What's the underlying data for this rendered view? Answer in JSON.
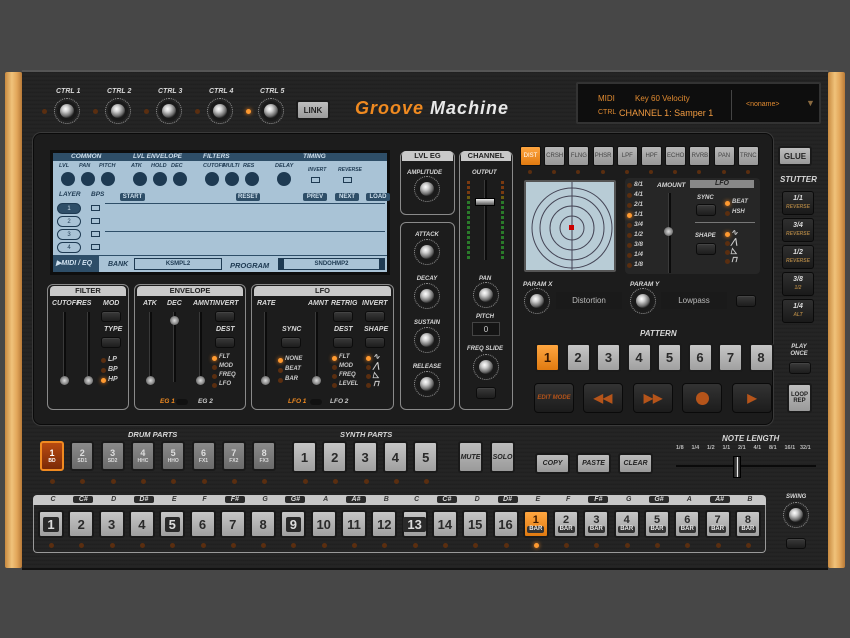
{
  "app": {
    "title_part1": "Groove",
    "title_part2": "Machine"
  },
  "top_controls": {
    "knobs": [
      {
        "label": "CTRL 1"
      },
      {
        "label": "CTRL 2"
      },
      {
        "label": "CTRL 3"
      },
      {
        "label": "CTRL 4"
      },
      {
        "label": "CTRL 5"
      }
    ],
    "active_led_index": 4,
    "link_label": "LINK"
  },
  "midi_display": {
    "midi_label": "MIDI",
    "midi_value": "Key 60 Velocity",
    "ctrl_label": "CTRL",
    "ctrl_value": "CHANNEL 1: Samper 1",
    "preset": "<noname>"
  },
  "lcd": {
    "sections": [
      "COMMON",
      "LVL ENVELOPE",
      "FILTERS",
      "TIMING"
    ],
    "knob_labels": [
      "LVL",
      "PAN",
      "PITCH",
      "ATK",
      "HOLD",
      "DEC",
      "CUTOFF",
      "MULTI",
      "RES",
      "DELAY"
    ],
    "toggle_labels": [
      "INVERT",
      "REVERSE"
    ],
    "layer_header": "LAYER",
    "bps_header": "BPS",
    "layers": [
      "1",
      "2",
      "3",
      "4"
    ],
    "selected_layer": 0,
    "buttons": [
      "START",
      "RESET",
      "PREV",
      "NEXT",
      "LOAD"
    ],
    "midi_eq": "MIDI / EQ",
    "bank_label": "BANK",
    "bank_value": "KSMPL2",
    "program_label": "PROGRAM",
    "program_value": "SNDOHMP2"
  },
  "filter": {
    "title": "FILTER",
    "sliders": [
      "CUTOFF",
      "RES"
    ],
    "mod_label": "MOD",
    "type_label": "TYPE",
    "types": [
      "LP",
      "BP",
      "HP"
    ],
    "active_type": 2
  },
  "envelope": {
    "title": "ENVELOPE",
    "sliders": [
      "ATK",
      "DEC",
      "AMNT"
    ],
    "invert_label": "INVERT",
    "dest_label": "DEST",
    "dests": [
      "FLT",
      "MOD",
      "FREQ",
      "LFO"
    ],
    "active_dest": 0,
    "switch_a": "EG 1",
    "switch_b": "EG 2"
  },
  "lfo": {
    "title": "LFO",
    "sliders": [
      "RATE",
      "AMNT"
    ],
    "sync_label": "SYNC",
    "sync_opts": [
      "NONE",
      "BEAT",
      "BAR"
    ],
    "active_sync": 0,
    "retrig_label": "RETRIG",
    "invert_label": "INVERT",
    "dest_label": "DEST",
    "shape_label": "SHAPE",
    "dests": [
      "FLT",
      "MOD",
      "FREQ",
      "LEVEL"
    ],
    "active_dest": 0,
    "shapes": [
      "sine",
      "triangle",
      "saw",
      "square"
    ],
    "active_shape": 0,
    "switch_a": "LFO 1",
    "switch_b": "LFO 2"
  },
  "lvl_eg": {
    "title": "LVL EG",
    "amplitude": "AMPLITUDE",
    "knobs": [
      "ATTACK",
      "DECAY",
      "SUSTAIN",
      "RELEASE"
    ]
  },
  "channel": {
    "title": "CHANNEL",
    "output": "OUTPUT",
    "pan": "PAN",
    "pitch_label": "PITCH",
    "pitch_value": "0",
    "freq_slide": "FREQ SLIDE"
  },
  "fx": {
    "tabs": [
      "DIST",
      "CRSH",
      "FLNG",
      "PHSR",
      "LPF",
      "HPF",
      "ECHO",
      "RVRB",
      "PAN",
      "TRNC"
    ],
    "active_tab": 0,
    "rates": [
      "8/1",
      "4/1",
      "2/1",
      "1/1",
      "3/4",
      "1/2",
      "3/8",
      "1/4",
      "1/8"
    ],
    "active_rate": 3,
    "amount_label": "AMOUNT",
    "lfo_label": "LFO",
    "sync_label": "SYNC",
    "sync_opts": [
      "BEAT",
      "HSH"
    ],
    "active_sync": 0,
    "shape_label": "SHAPE",
    "param_x_label": "PARAM X",
    "param_x_value": "Distortion",
    "param_y_label": "PARAM Y",
    "param_y_value": "Lowpass"
  },
  "right_side": {
    "glue": "GLUE",
    "stutter": "STUTTER",
    "stutter_buttons": [
      {
        "top": "1/1",
        "sub": "REVERSE"
      },
      {
        "top": "3/4",
        "sub": "REVERSE"
      },
      {
        "top": "1/2",
        "sub": "REVERSE"
      },
      {
        "top": "3/8",
        "sub": "1/2"
      },
      {
        "top": "1/4",
        "sub": "ALT"
      }
    ],
    "play_once": "PLAY ONCE",
    "loop_rep": "LOOP REP"
  },
  "pattern": {
    "title": "PATTERN",
    "items": [
      "1",
      "2",
      "3",
      "4",
      "5",
      "6",
      "7",
      "8"
    ],
    "active": 0,
    "edit_mode": "EDIT MODE"
  },
  "drum_parts": {
    "title": "DRUM PARTS",
    "items": [
      {
        "n": "1",
        "s": "BD"
      },
      {
        "n": "2",
        "s": "SD1"
      },
      {
        "n": "3",
        "s": "SD2"
      },
      {
        "n": "4",
        "s": "HHC"
      },
      {
        "n": "5",
        "s": "HHO"
      },
      {
        "n": "6",
        "s": "FX1"
      },
      {
        "n": "7",
        "s": "FX2"
      },
      {
        "n": "8",
        "s": "FX3"
      }
    ],
    "active": 0
  },
  "synth_parts": {
    "title": "SYNTH PARTS",
    "items": [
      "1",
      "2",
      "3",
      "4",
      "5"
    ]
  },
  "actions": {
    "mute": "MUTE",
    "solo": "SOLO",
    "copy": "COPY",
    "paste": "PASTE",
    "clear": "CLEAR"
  },
  "note_length": {
    "title": "NOTE LENGTH",
    "ticks": [
      "1/8",
      "1/4",
      "1/2",
      "1/1",
      "2/1",
      "4/1",
      "8/1",
      "16/1",
      "32/1"
    ],
    "value": "2/1"
  },
  "sequencer": {
    "notes": [
      "C",
      "C#",
      "D",
      "D#",
      "E",
      "F",
      "F#",
      "G",
      "G#",
      "A",
      "A#",
      "B",
      "C",
      "C#",
      "D",
      "D#",
      "E",
      "F",
      "F#",
      "G",
      "G#",
      "A",
      "A#",
      "B"
    ],
    "steps": [
      "1",
      "2",
      "3",
      "4",
      "5",
      "6",
      "7",
      "8",
      "9",
      "10",
      "11",
      "12",
      "13",
      "14",
      "15",
      "16"
    ],
    "dark_steps": [
      0,
      4,
      8,
      12
    ],
    "bars": [
      "1",
      "2",
      "3",
      "4",
      "5",
      "6",
      "7",
      "8"
    ],
    "bar_label": "BAR",
    "active_bar": 0
  },
  "swing": "SWING"
}
